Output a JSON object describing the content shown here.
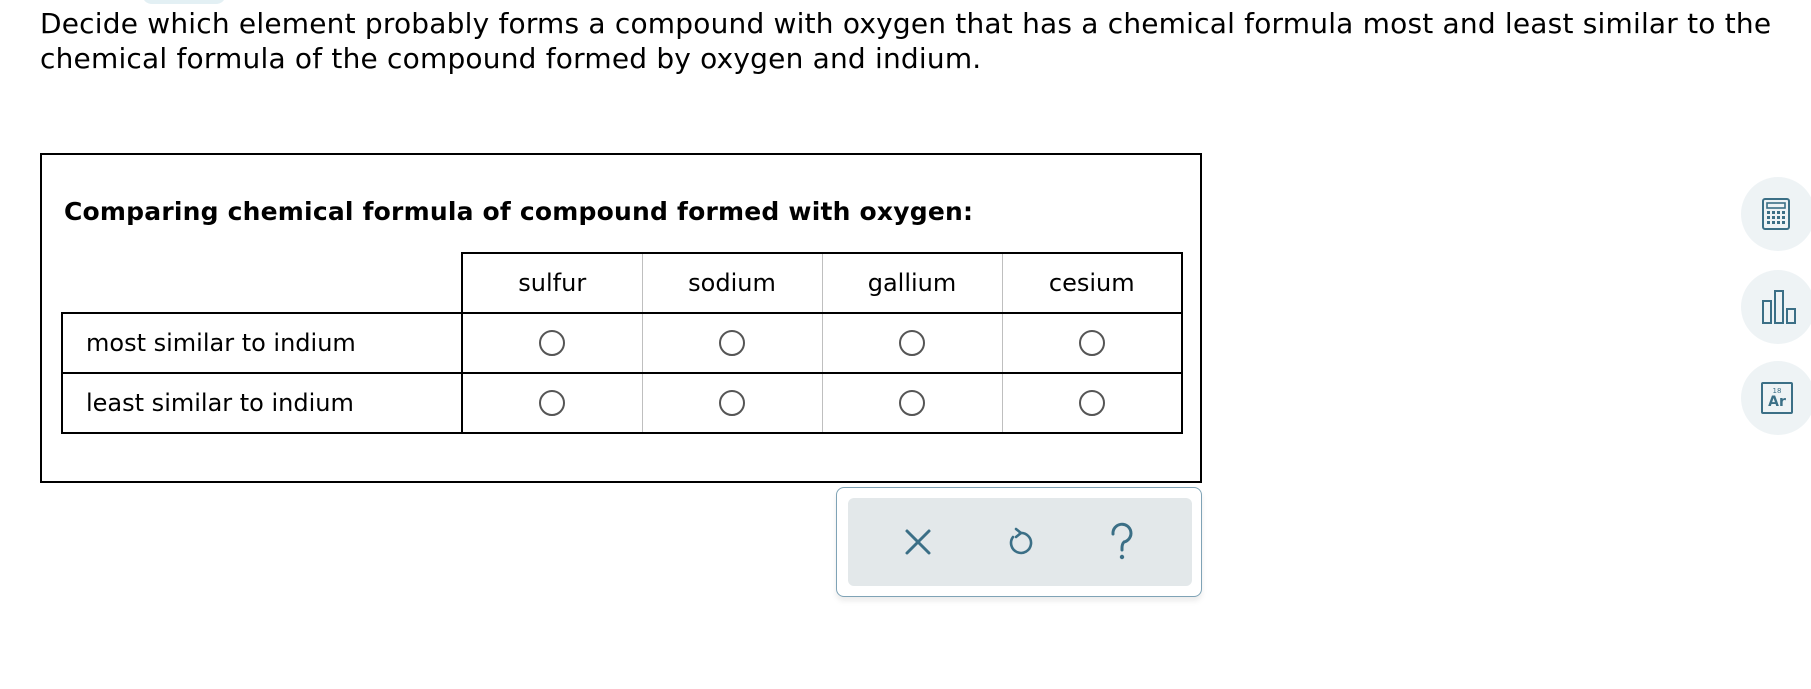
{
  "question": {
    "text": "Decide which element probably forms a compound with oxygen that has a chemical formula most and least similar to the chemical formula of the compound formed by oxygen and indium."
  },
  "panel": {
    "title": "Comparing chemical formula of compound formed with oxygen:",
    "columns": [
      "sulfur",
      "sodium",
      "gallium",
      "cesium"
    ],
    "rows": [
      {
        "label": "most similar to indium",
        "selected": null
      },
      {
        "label": "least similar to indium",
        "selected": null
      }
    ]
  },
  "actions": {
    "clear": "close-icon",
    "undo": "undo-icon",
    "help": "help-icon"
  },
  "side_tools": {
    "calculator": "calculator-icon",
    "chart": "bar-chart-icon",
    "periodic_table": {
      "icon": "periodic-table-icon",
      "number": "18",
      "symbol": "Ar"
    }
  },
  "colors": {
    "accent": "#3b6f86",
    "action_bg": "#e3e8ea",
    "side_btn_bg": "#eef3f5"
  }
}
